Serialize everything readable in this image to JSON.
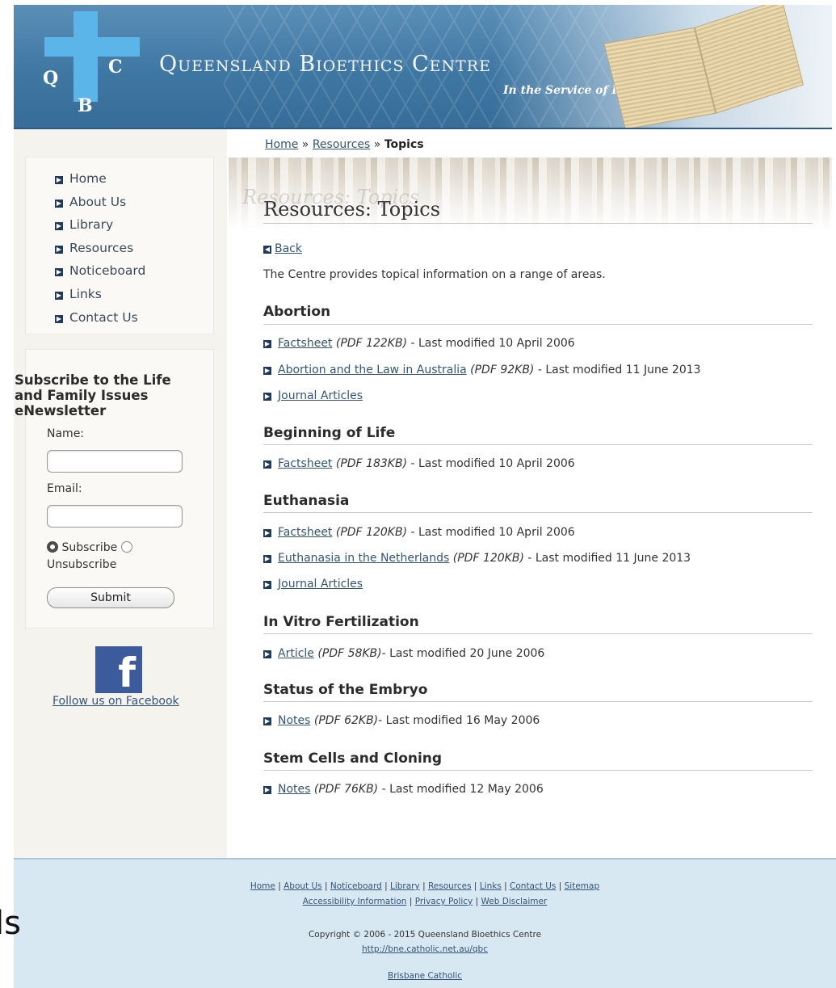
{
  "header": {
    "logo_letters": [
      "Q",
      "C",
      "B"
    ],
    "site_title": "Queensland Bioethics Centre",
    "tagline": "In the Service of Life"
  },
  "sidebar": {
    "nav": [
      {
        "label": "Home",
        "icon": "arrow-right-icon"
      },
      {
        "label": "About Us",
        "icon": "arrow-right-icon"
      },
      {
        "label": "Library",
        "icon": "arrow-right-icon"
      },
      {
        "label": "Resources",
        "icon": "arrow-right-icon"
      },
      {
        "label": "Noticeboard",
        "icon": "arrow-right-icon"
      },
      {
        "label": "Links",
        "icon": "arrow-right-icon"
      },
      {
        "label": "Contact Us",
        "icon": "arrow-right-icon"
      }
    ],
    "subscribe": {
      "title": "Subscribe to the Life and Family Issues eNewsletter",
      "name_label": "Name:",
      "name_value": "",
      "email_label": "Email:",
      "email_value": "",
      "subscribe_label": "Subscribe",
      "unsubscribe_label": "Unsubscribe",
      "selected": "subscribe",
      "submit_label": "Submit"
    },
    "facebook": {
      "icon": "facebook-icon",
      "link_text": "Follow us on Facebook",
      "brand_color": "#3b5b9c"
    }
  },
  "breadcrumb": {
    "home": "Home",
    "sep": "»",
    "resources": "Resources",
    "current": "Topics"
  },
  "main": {
    "hero_watermark": "Resources: Topics",
    "title": "Resources: Topics",
    "back_label": "Back",
    "intro": "The Centre provides topical information on a range of areas.",
    "sections": [
      {
        "title": "Abortion",
        "items": [
          {
            "link": "Factsheet",
            "format": "(PDF 122KB)",
            "meta": " - Last modified 10 April 2006"
          },
          {
            "link": "Abortion and the Law in Australia",
            "format": "(PDF 92KB)",
            "meta": " - Last modified 11 June 2013"
          },
          {
            "link": "Journal Articles",
            "format": "",
            "meta": ""
          }
        ]
      },
      {
        "title": "Beginning of Life",
        "items": [
          {
            "link": "Factsheet",
            "format": "(PDF 183KB)",
            "meta": " - Last modified 10 April 2006"
          }
        ]
      },
      {
        "title": "Euthanasia",
        "items": [
          {
            "link": "Factsheet",
            "format": "(PDF 120KB)",
            "meta": " - Last modified 10 April 2006"
          },
          {
            "link": "Euthanasia in the Netherlands",
            "format": "(PDF 120KB)",
            "meta": " - Last modified 11 June 2013"
          },
          {
            "link": "Journal Articles",
            "format": "",
            "meta": ""
          }
        ]
      },
      {
        "title": "In Vitro Fertilization",
        "items": [
          {
            "link": "Article",
            "format": "(PDF 58KB)",
            "meta": "- Last modified 20 June 2006"
          }
        ]
      },
      {
        "title": "Status of the Embryo",
        "items": [
          {
            "link": "Notes",
            "format": "(PDF 62KB)",
            "meta": "- Last modified 16 May 2006"
          }
        ]
      },
      {
        "title": "Stem Cells and Cloning",
        "items": [
          {
            "link": "Notes",
            "format": "(PDF 76KB)",
            "meta": " - Last modified 12 May 2006"
          }
        ]
      }
    ]
  },
  "footer": {
    "links_row1": [
      "Home",
      "About Us",
      "Noticeboard",
      "Library",
      "Resources",
      "Links",
      "Contact Us",
      "Sitemap"
    ],
    "links_row2": [
      "Accessibility Information",
      "Privacy Policy",
      "Web Disclaimer"
    ],
    "separator": "|",
    "copyright": "Copyright © 2006 - 2015 Queensland Bioethics Centre",
    "url": "http://bne.catholic.net.au/qbc",
    "brisbane": "Brisbane Catholic"
  },
  "overlay_text": "ls"
}
